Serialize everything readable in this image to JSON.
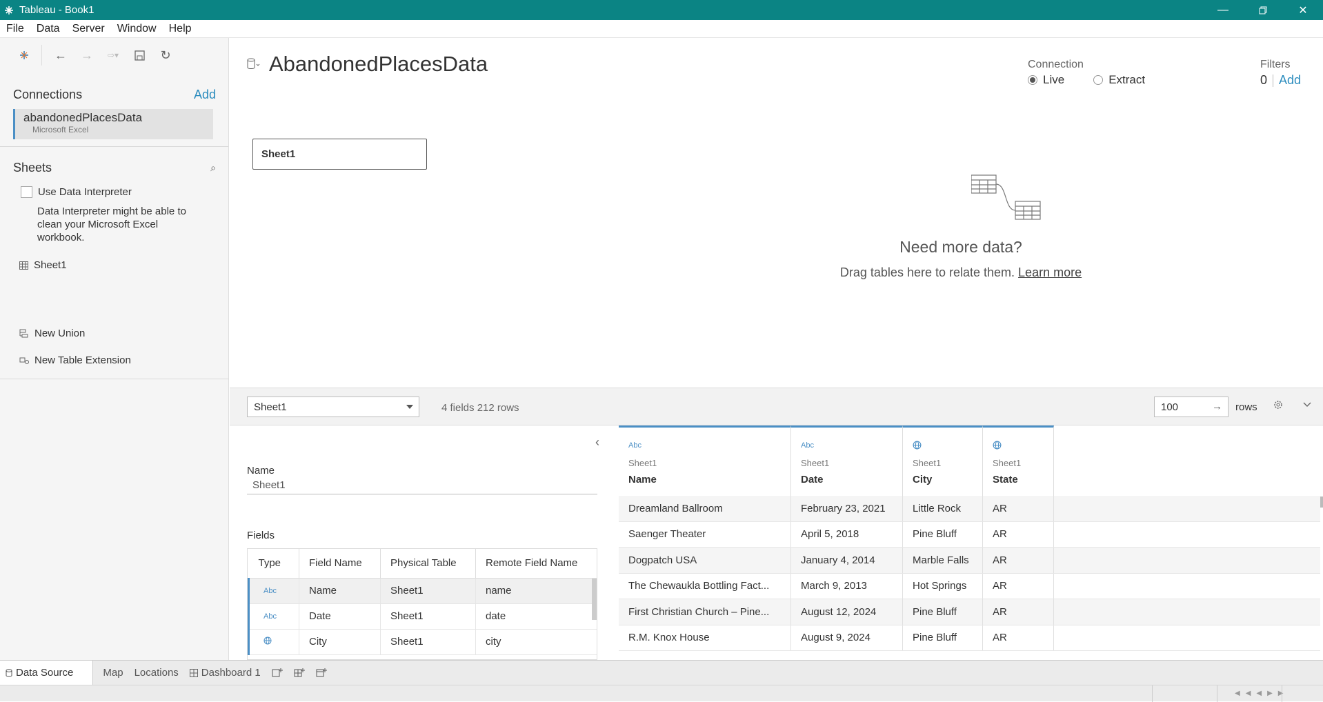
{
  "window": {
    "title": "Tableau - Book1"
  },
  "menu": [
    "File",
    "Data",
    "Server",
    "Window",
    "Help"
  ],
  "left": {
    "connections_label": "Connections",
    "add_label": "Add",
    "connection": {
      "name": "abandonedPlacesData",
      "type": "Microsoft Excel"
    },
    "sheets_label": "Sheets",
    "use_interpreter": "Use Data Interpreter",
    "interpreter_note": "Data Interpreter might be able to clean your Microsoft Excel workbook.",
    "sheet_item": "Sheet1",
    "new_union": "New Union",
    "new_extension": "New Table Extension"
  },
  "canvas": {
    "datasource_name": "AbandonedPlacesData",
    "connection_label": "Connection",
    "live_label": "Live",
    "extract_label": "Extract",
    "filters_label": "Filters",
    "filters_count": "0",
    "filters_add": "Add",
    "sheet_box": "Sheet1",
    "need_more": "Need more data?",
    "drag_text": "Drag tables here to relate them.",
    "learn_more": "Learn more"
  },
  "midbar": {
    "table_select": "Sheet1",
    "fields_rows": "4 fields 212 rows",
    "rows_value": "100",
    "rows_label": "rows"
  },
  "meta": {
    "name_label": "Name",
    "name_value": "Sheet1",
    "fields_label": "Fields",
    "headers": [
      "Type",
      "Field Name",
      "Physical Table",
      "Remote Field Name"
    ],
    "rows": [
      {
        "type": "Abc",
        "field": "Name",
        "table": "Sheet1",
        "remote": "name"
      },
      {
        "type": "Abc",
        "field": "Date",
        "table": "Sheet1",
        "remote": "date"
      },
      {
        "type": "globe",
        "field": "City",
        "table": "Sheet1",
        "remote": "city"
      }
    ]
  },
  "grid": {
    "columns": [
      {
        "type": "Abc",
        "table": "Sheet1",
        "name": "Name"
      },
      {
        "type": "Abc",
        "table": "Sheet1",
        "name": "Date"
      },
      {
        "type": "globe",
        "table": "Sheet1",
        "name": "City"
      },
      {
        "type": "globe",
        "table": "Sheet1",
        "name": "State"
      }
    ],
    "rows": [
      [
        "Dreamland Ballroom",
        "February 23, 2021",
        "Little Rock",
        "AR"
      ],
      [
        "Saenger Theater",
        "April 5, 2018",
        "Pine Bluff",
        "AR"
      ],
      [
        "Dogpatch USA",
        "January 4, 2014",
        "Marble Falls",
        "AR"
      ],
      [
        "The Chewaukla Bottling Fact...",
        "March 9, 2013",
        "Hot Springs",
        "AR"
      ],
      [
        "First Christian Church – Pine...",
        "August 12, 2024",
        "Pine Bluff",
        "AR"
      ],
      [
        "R.M. Knox House",
        "August 9, 2024",
        "Pine Bluff",
        "AR"
      ]
    ]
  },
  "tabs": {
    "data_source": "Data Source",
    "sheets": [
      "Map",
      "Locations"
    ],
    "dashboard": "Dashboard 1"
  },
  "colors": {
    "titlebar": "#0b8484",
    "accent": "#2b8cbe",
    "type_icon": "#4b8fc5"
  }
}
